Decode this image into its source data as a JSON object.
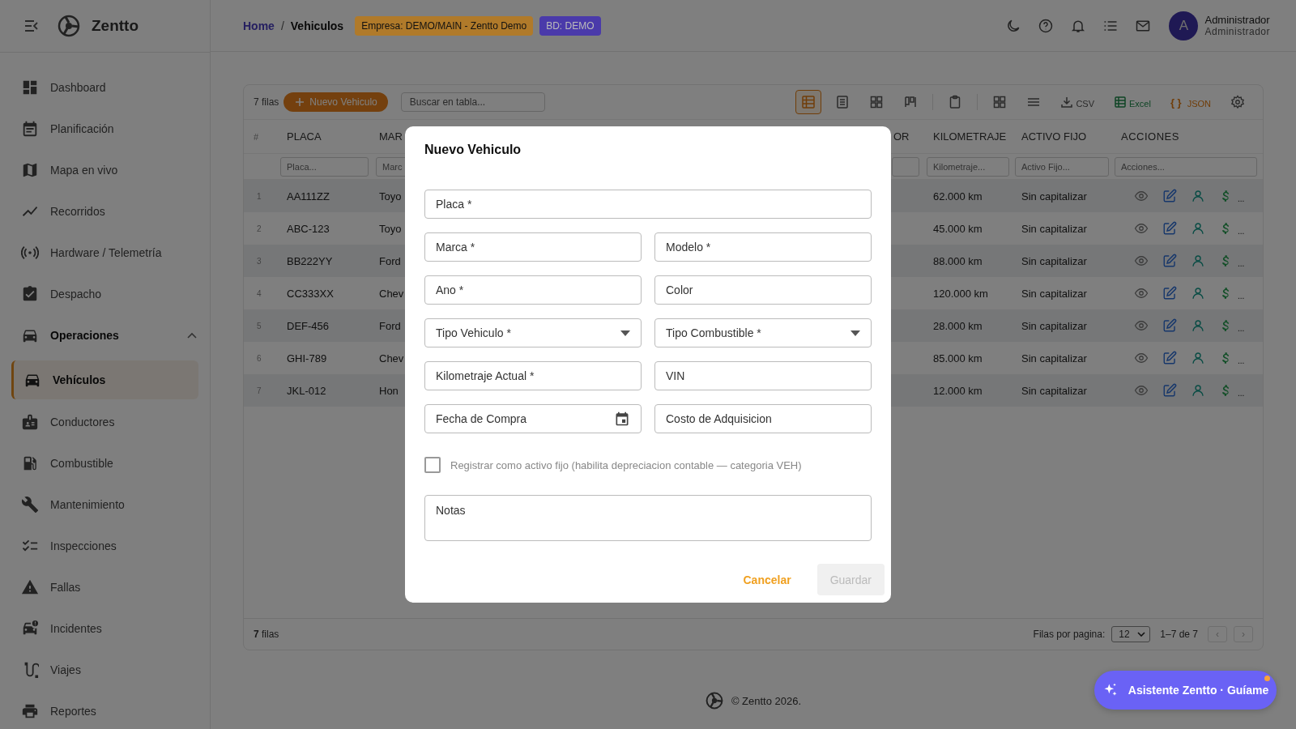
{
  "brand": {
    "name": "Zentto"
  },
  "breadcrumb": {
    "separator": "/",
    "items": [
      {
        "label": "Home",
        "selected": false
      },
      {
        "label": "Vehiculos",
        "selected": true
      }
    ]
  },
  "badges": [
    {
      "label": "Empresa: DEMO/MAIN - Zentto Demo",
      "color": "#b07a2a"
    },
    {
      "label": "BD: DEMO",
      "color": "#4a3aaa"
    }
  ],
  "user": {
    "initial": "A",
    "name": "Administrador",
    "role": "Administrador"
  },
  "sidebar": {
    "items": [
      {
        "label": "Dashboard",
        "selected": false
      },
      {
        "label": "Planificación",
        "selected": false
      },
      {
        "label": "Mapa en vivo",
        "selected": false
      },
      {
        "label": "Recorridos",
        "selected": false
      },
      {
        "label": "Hardware / Telemetría",
        "selected": false
      },
      {
        "label": "Despacho",
        "selected": false
      },
      {
        "label": "Operaciones",
        "selected": false,
        "expanded": true,
        "children": [
          {
            "label": "Vehículos",
            "selected": true
          }
        ]
      },
      {
        "label": "Conductores",
        "selected": false
      },
      {
        "label": "Combustible",
        "selected": false
      },
      {
        "label": "Mantenimiento",
        "selected": false
      },
      {
        "label": "Inspecciones",
        "selected": false
      },
      {
        "label": "Fallas",
        "selected": false
      },
      {
        "label": "Incidentes",
        "selected": false
      },
      {
        "label": "Viajes",
        "selected": false
      },
      {
        "label": "Reportes",
        "selected": false
      }
    ]
  },
  "toolbar": {
    "count": "7 filas",
    "add_button": "Nuevo Vehiculo",
    "search": {
      "placeholder": "Buscar en tabla..."
    },
    "view_modes": [
      {
        "selected": true
      },
      {
        "selected": false
      },
      {
        "selected": false
      },
      {
        "selected": false
      }
    ],
    "exports": [
      {
        "label": "CSV"
      },
      {
        "label": "Excel"
      },
      {
        "label": "JSON",
        "symbol": "{ }"
      }
    ]
  },
  "table": {
    "columns": [
      {
        "label": "#"
      },
      {
        "label": "PLACA",
        "filter_field": true,
        "placeholder": "Placa..."
      },
      {
        "label": "MAR",
        "filter_field": true,
        "placeholder": "Marc"
      },
      {
        "label": "OR",
        "filter_field": true
      },
      {
        "label": "KILOMETRAJE",
        "filter_field": true,
        "placeholder": "Kilometraje..."
      },
      {
        "label": "ACTIVO FIJO",
        "filter_field": true,
        "placeholder": "Activo Fijo..."
      },
      {
        "label": "ACCIONES",
        "filter_field": true,
        "placeholder": "Acciones..."
      }
    ],
    "rows": [
      {
        "num": "1",
        "placa": "AA111ZZ",
        "column_3": "Toyo",
        "kilometraje": "62.000 km",
        "activo_fijo": "Sin capitalizar",
        "more": "..."
      },
      {
        "num": "2",
        "placa": "ABC-123",
        "column_3": "Toyo",
        "kilometraje": "45.000 km",
        "activo_fijo": "Sin capitalizar",
        "more": "..."
      },
      {
        "num": "3",
        "placa": "BB222YY",
        "column_3": "Ford",
        "kilometraje": "88.000 km",
        "activo_fijo": "Sin capitalizar",
        "more": "..."
      },
      {
        "num": "4",
        "placa": "CC333XX",
        "column_3": "Chev",
        "kilometraje": "120.000 km",
        "activo_fijo": "Sin capitalizar",
        "more": "..."
      },
      {
        "num": "5",
        "placa": "DEF-456",
        "column_3": "Ford",
        "kilometraje": "28.000 km",
        "activo_fijo": "Sin capitalizar",
        "more": "..."
      },
      {
        "num": "6",
        "placa": "GHI-789",
        "column_3": "Chev",
        "kilometraje": "85.000 km",
        "activo_fijo": "Sin capitalizar",
        "more": "..."
      },
      {
        "num": "7",
        "placa": "JKL-012",
        "column_3": "Hon",
        "kilometraje": "12.000 km",
        "activo_fijo": "Sin capitalizar",
        "more": "..."
      }
    ],
    "footer": {
      "count": "**7** filas",
      "rows_per_page_label": "Filas por pagina:",
      "rows_per_page": "12",
      "range": "1–7 de 7",
      "prev": {
        "label": "‹",
        "disabled": true
      },
      "next": {
        "label": "›",
        "disabled": true
      }
    }
  },
  "copyright": "© Zentto 2026.",
  "assistant": {
    "label": "Asistente Zentto · Guíame",
    "notification": true
  },
  "dialog": {
    "title": "Nuevo Vehiculo",
    "fields": [
      {
        "kind": "text",
        "placeholder": "Placa *"
      },
      {
        "kind": "text",
        "placeholder": "Marca *"
      },
      {
        "kind": "text",
        "placeholder": "Modelo *"
      },
      {
        "kind": "text",
        "placeholder": "Ano *"
      },
      {
        "kind": "text",
        "placeholder": "Color"
      },
      {
        "kind": "select",
        "placeholder": "Tipo Vehiculo *"
      },
      {
        "kind": "select",
        "placeholder": "Tipo Combustible *"
      },
      {
        "kind": "text",
        "placeholder": "Kilometraje Actual *"
      },
      {
        "kind": "text",
        "placeholder": "VIN"
      },
      {
        "kind": "date",
        "placeholder": "Fecha de Compra"
      },
      {
        "kind": "text",
        "placeholder": "Costo de Adquisicion"
      }
    ],
    "checkbox": {
      "label": "Registrar como activo fijo (habilita depreciacion contable — categoria VEH)",
      "checked": false
    },
    "notes": {
      "placeholder": "Notas"
    },
    "buttons": [
      {
        "label": "Cancelar",
        "kind": "text",
        "disabled": false
      },
      {
        "label": "Guardar",
        "kind": "filled",
        "disabled": true
      }
    ]
  }
}
